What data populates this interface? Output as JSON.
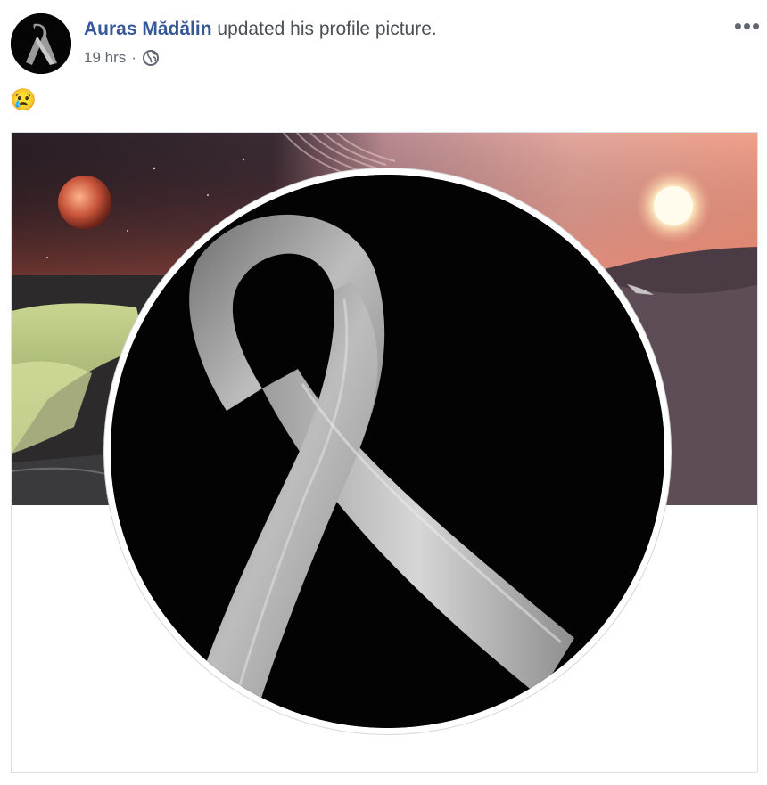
{
  "post": {
    "author_name": "Auras Mădălin",
    "action_text": "updated his profile picture.",
    "timestamp": "19 hrs",
    "separator": "·",
    "privacy_icon": "globe-icon",
    "more_icon": "more-options-icon",
    "more_label": "•••",
    "emoji": "😢",
    "photo": {
      "cover_description_icon": "cover-photo",
      "profile_description_icon": "black-ribbon-profile-picture"
    }
  },
  "colors": {
    "author": "#365899",
    "secondary_text": "#606770",
    "border": "#dddfe2"
  }
}
